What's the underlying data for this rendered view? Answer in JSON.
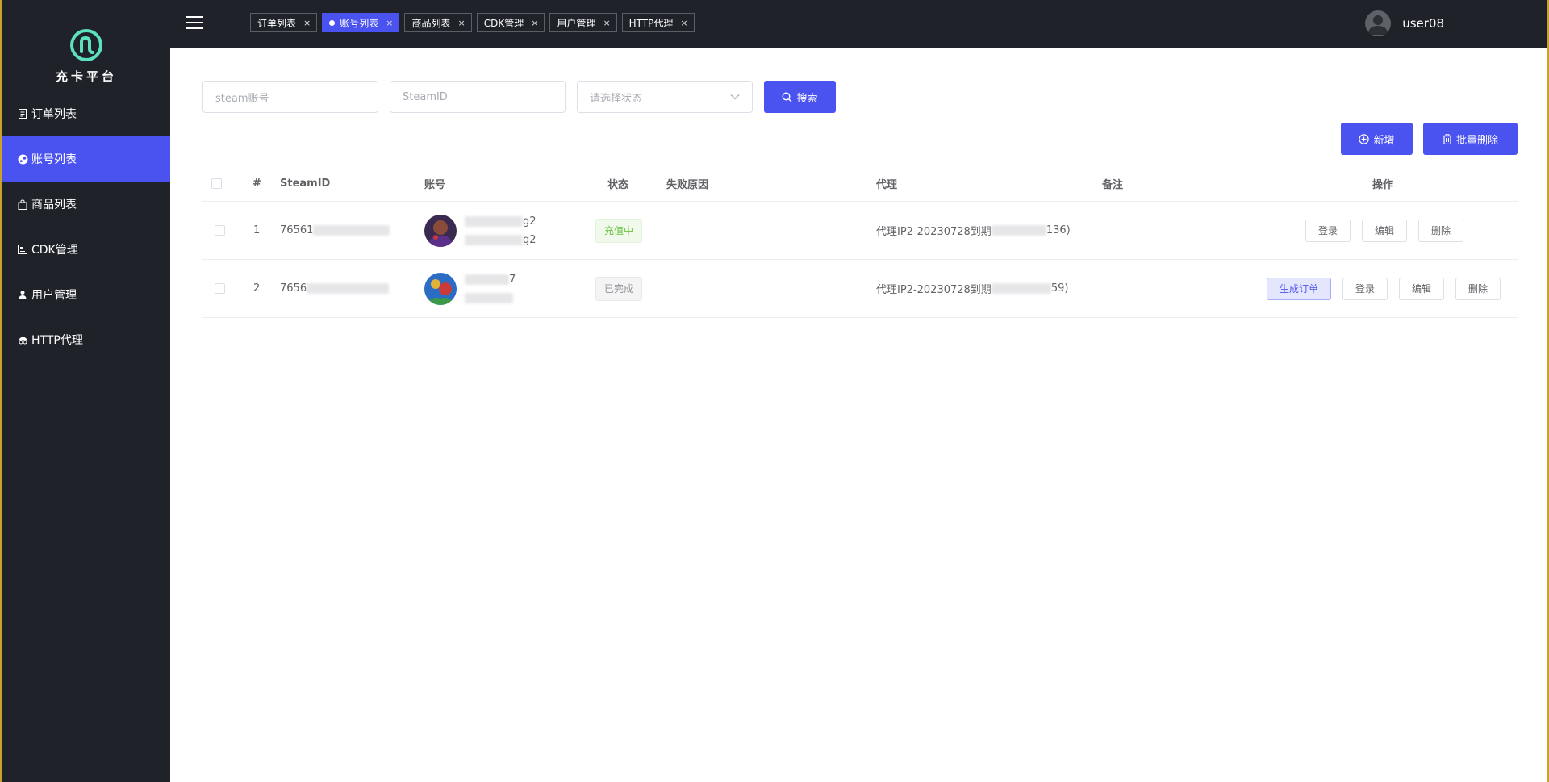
{
  "app": {
    "name": "充卡平台"
  },
  "sidebar": {
    "items": [
      {
        "label": "订单列表",
        "icon": "document-icon",
        "active": false
      },
      {
        "label": "账号列表",
        "icon": "steam-icon",
        "active": true
      },
      {
        "label": "商品列表",
        "icon": "bag-icon",
        "active": false
      },
      {
        "label": "CDK管理",
        "icon": "cdk-icon",
        "active": false
      },
      {
        "label": "用户管理",
        "icon": "user-icon",
        "active": false
      },
      {
        "label": "HTTP代理",
        "icon": "proxy-icon",
        "active": false
      }
    ]
  },
  "tabs": [
    {
      "label": "订单列表",
      "active": false
    },
    {
      "label": "账号列表",
      "active": true
    },
    {
      "label": "商品列表",
      "active": false
    },
    {
      "label": "CDK管理",
      "active": false
    },
    {
      "label": "用户管理",
      "active": false
    },
    {
      "label": "HTTP代理",
      "active": false
    }
  ],
  "user": {
    "name": "user08"
  },
  "filters": {
    "steam_account_placeholder": "steam账号",
    "steamid_placeholder": "SteamID",
    "status_placeholder": "请选择状态",
    "search_label": "搜索"
  },
  "actions": {
    "add_label": "新增",
    "bulk_delete_label": "批量删除"
  },
  "table": {
    "headers": {
      "index": "#",
      "steamid": "SteamID",
      "account": "账号",
      "status": "状态",
      "fail_reason": "失败原因",
      "proxy": "代理",
      "remark": "备注",
      "ops": "操作"
    },
    "rows": [
      {
        "index": "1",
        "steamid_prefix": "76561",
        "account_line1_suffix": "g2",
        "account_line2_suffix": "g2",
        "status": "充值中",
        "fail_reason": "",
        "proxy_prefix": "代理IP2-20230728到期",
        "proxy_suffix": "136)",
        "remark": "",
        "buttons": {
          "login": "登录",
          "edit": "编辑",
          "delete": "删除"
        }
      },
      {
        "index": "2",
        "steamid_prefix": "7656",
        "account_line1_suffix": "7",
        "account_line2_suffix": "",
        "status": "已完成",
        "fail_reason": "",
        "proxy_prefix": "代理IP2-20230728到期",
        "proxy_suffix": "59)",
        "remark": "",
        "buttons": {
          "order": "生成订单",
          "login": "登录",
          "edit": "编辑",
          "delete": "删除"
        }
      }
    ]
  },
  "colors": {
    "accent": "#4a52f0",
    "sidebar_bg": "#1f2329",
    "frame": "#c9a227",
    "status_green": "#67c23a",
    "status_gray": "#909399"
  }
}
